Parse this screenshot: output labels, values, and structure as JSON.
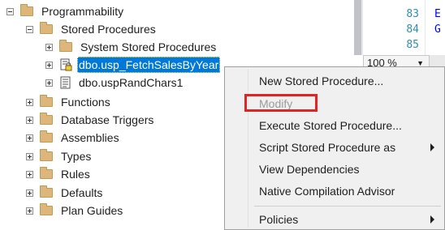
{
  "tree": {
    "items": [
      {
        "label": "Programmability",
        "expander": "minus",
        "icon": "folder-icon",
        "selected": false
      },
      {
        "label": "Stored Procedures",
        "expander": "minus",
        "icon": "folder-icon",
        "selected": false
      },
      {
        "label": "System Stored Procedures",
        "expander": "plus",
        "icon": "folder-icon",
        "selected": false
      },
      {
        "label": "dbo.usp_FetchSalesByYear",
        "expander": "plus",
        "icon": "stored-procedure-lock-icon",
        "selected": true
      },
      {
        "label": "dbo.uspRandChars1",
        "expander": "plus",
        "icon": "stored-procedure-icon",
        "selected": false
      },
      {
        "label": "Functions",
        "expander": "plus",
        "icon": "folder-icon",
        "selected": false
      },
      {
        "label": "Database Triggers",
        "expander": "plus",
        "icon": "folder-icon",
        "selected": false
      },
      {
        "label": "Assemblies",
        "expander": "plus",
        "icon": "folder-icon",
        "selected": false
      },
      {
        "label": "Types",
        "expander": "plus",
        "icon": "folder-icon",
        "selected": false
      },
      {
        "label": "Rules",
        "expander": "plus",
        "icon": "folder-icon",
        "selected": false
      },
      {
        "label": "Defaults",
        "expander": "plus",
        "icon": "folder-icon",
        "selected": false
      },
      {
        "label": "Plan Guides",
        "expander": "plus",
        "icon": "folder-icon",
        "selected": false
      }
    ]
  },
  "editor": {
    "line_numbers": [
      "83",
      "84",
      "85"
    ],
    "code_fragments": [
      "E",
      "G"
    ],
    "zoom_level": "100 %"
  },
  "context_menu": {
    "items": [
      {
        "label": "New Stored Procedure...",
        "enabled": true,
        "submenu": false
      },
      {
        "label": "Modify",
        "enabled": false,
        "submenu": false,
        "highlighted": true
      },
      {
        "label": "Execute Stored Procedure...",
        "enabled": true,
        "submenu": false
      },
      {
        "label": "Script Stored Procedure as",
        "enabled": true,
        "submenu": true
      },
      {
        "label": "View Dependencies",
        "enabled": true,
        "submenu": false
      },
      {
        "label": "Native Compilation Advisor",
        "enabled": true,
        "submenu": false
      },
      {
        "label": "Policies",
        "enabled": true,
        "submenu": true
      }
    ]
  },
  "colors": {
    "selection": "#0078d7",
    "highlight_box": "#e02424",
    "folder": "#dcb67a",
    "line_number": "#2b91af"
  }
}
